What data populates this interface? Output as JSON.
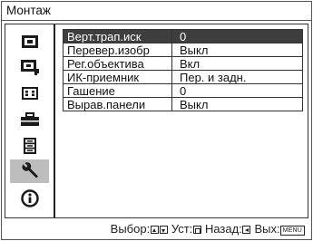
{
  "title": "Монтаж",
  "sidebar": {
    "items": [
      {
        "name": "picture-icon",
        "active": false
      },
      {
        "name": "picture-adjust-icon",
        "active": false
      },
      {
        "name": "screen-icon",
        "active": false
      },
      {
        "name": "toolbox-icon",
        "active": false
      },
      {
        "name": "menu-list-icon",
        "active": false
      },
      {
        "name": "wrench-icon",
        "active": true
      },
      {
        "name": "info-icon",
        "active": false
      }
    ]
  },
  "menu": {
    "rows": [
      {
        "label": "Верт.трап.иск",
        "value": "0",
        "selected": true
      },
      {
        "label": "Перевер.изобр",
        "value": "Выкл",
        "selected": false
      },
      {
        "label": "Рег.объектива",
        "value": "Вкл",
        "selected": false
      },
      {
        "label": "ИК-приемник",
        "value": "Пер. и задн.",
        "selected": false
      },
      {
        "label": "Гашение",
        "value": "0",
        "selected": false
      },
      {
        "label": "Вырав.панели",
        "value": "Выкл",
        "selected": false
      }
    ]
  },
  "footer": {
    "select_label": "Выбор:",
    "set_label": "Уст:",
    "back_label": "Назад:",
    "exit_label": "Вых:",
    "menu_key": "MENU"
  },
  "colors": {
    "selected_bg": "#3e3e3e",
    "active_icon_bg": "#bdbdbd",
    "border": "#333333"
  }
}
